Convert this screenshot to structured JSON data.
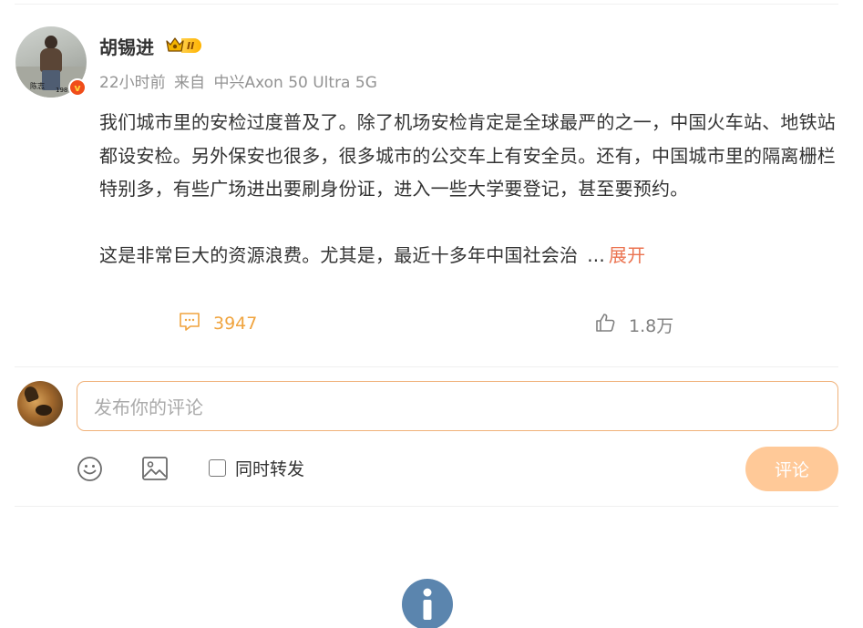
{
  "post": {
    "author": {
      "name": "胡锡进",
      "avatar_signature": "陈志",
      "avatar_year": "198",
      "verified_badge_icon": "v-badge-icon",
      "vip_level": "II"
    },
    "meta": {
      "time": "22小时前",
      "source_prefix": "来自",
      "device": "中兴Axon 50 Ultra 5G"
    },
    "content": {
      "paragraph1": "我们城市里的安检过度普及了。除了机场安检肯定是全球最严的之一，中国火车站、地铁站都设安检。另外保安也很多，很多城市的公交车上有安全员。还有，中国城市里的隔离栅栏特别多，有些广场进出要刷身份证，进入一些大学要登记，甚至要预约。",
      "paragraph2": "这是非常巨大的资源浪费。尤其是，最近十多年中国社会治",
      "ellipsis": "...",
      "expand_label": "展开"
    },
    "actions": {
      "comment_count": "3947",
      "like_count": "1.8万"
    }
  },
  "reply": {
    "placeholder": "发布你的评论",
    "repost_label": "同时转发",
    "submit_label": "评论"
  },
  "colors": {
    "accent_orange": "#eb7350",
    "comment_count_color": "#f0a43f",
    "submit_bg": "#ffc998",
    "input_border": "#f0b27a",
    "info_icon_bg": "#5b85ae"
  }
}
